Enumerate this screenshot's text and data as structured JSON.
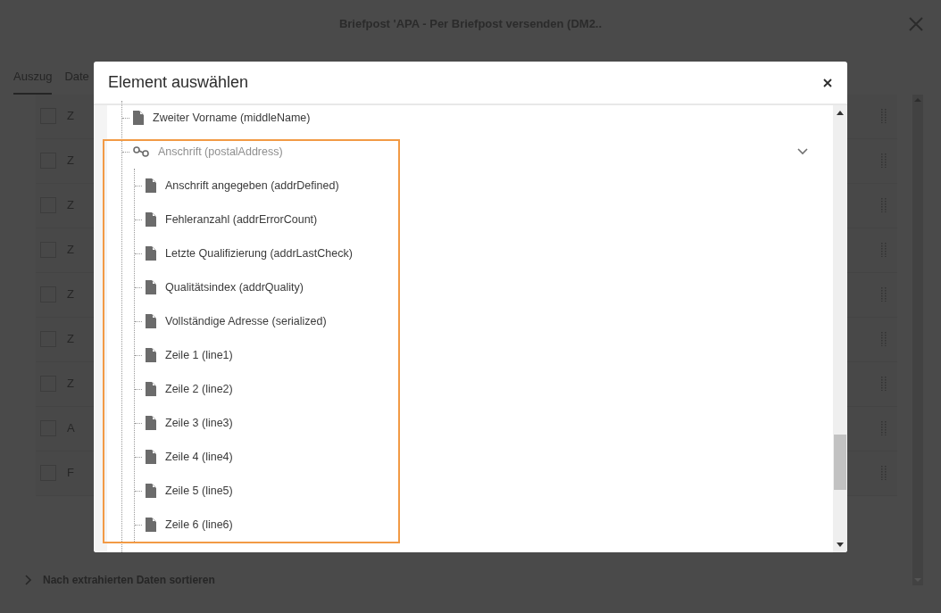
{
  "page": {
    "title": "Briefpost 'APA - Per Briefpost versenden (DM2..",
    "tabs": [
      {
        "label": "Auszug",
        "selected": true
      },
      {
        "label": "Date",
        "selected": false
      }
    ],
    "rows": [
      {
        "label": "Z",
        "checked": false
      },
      {
        "label": "Z",
        "checked": false
      },
      {
        "label": "Z",
        "checked": false
      },
      {
        "label": "Z",
        "checked": false
      },
      {
        "label": "Z",
        "checked": false
      },
      {
        "label": "Z",
        "checked": false
      },
      {
        "label": "Z",
        "checked": false
      },
      {
        "label": "A",
        "checked": false
      },
      {
        "label": "F",
        "checked": false
      }
    ],
    "sort_section": {
      "label": "Nach extrahierten Daten sortieren",
      "expanded": false
    }
  },
  "dialog": {
    "title": "Element auswählen",
    "tree": [
      {
        "kind": "field",
        "label": "Zweiter Vorname (middleName)"
      },
      {
        "kind": "link",
        "label": "Anschrift (postalAddress)",
        "expanded": true,
        "highlighted": true,
        "children": [
          {
            "kind": "field",
            "label": "Anschrift angegeben (addrDefined)"
          },
          {
            "kind": "field",
            "label": "Fehleranzahl (addrErrorCount)"
          },
          {
            "kind": "field",
            "label": "Letzte Qualifizierung (addrLastCheck)"
          },
          {
            "kind": "field",
            "label": "Qualitätsindex (addrQuality)"
          },
          {
            "kind": "field",
            "label": "Vollständige Adresse (serialized)"
          },
          {
            "kind": "field",
            "label": "Zeile 1 (line1)"
          },
          {
            "kind": "field",
            "label": "Zeile 2 (line2)"
          },
          {
            "kind": "field",
            "label": "Zeile 3 (line3)"
          },
          {
            "kind": "field",
            "label": "Zeile 4 (line4)"
          },
          {
            "kind": "field",
            "label": "Zeile 5 (line5)"
          },
          {
            "kind": "field",
            "label": "Zeile 6 (line6)"
          }
        ]
      }
    ]
  }
}
